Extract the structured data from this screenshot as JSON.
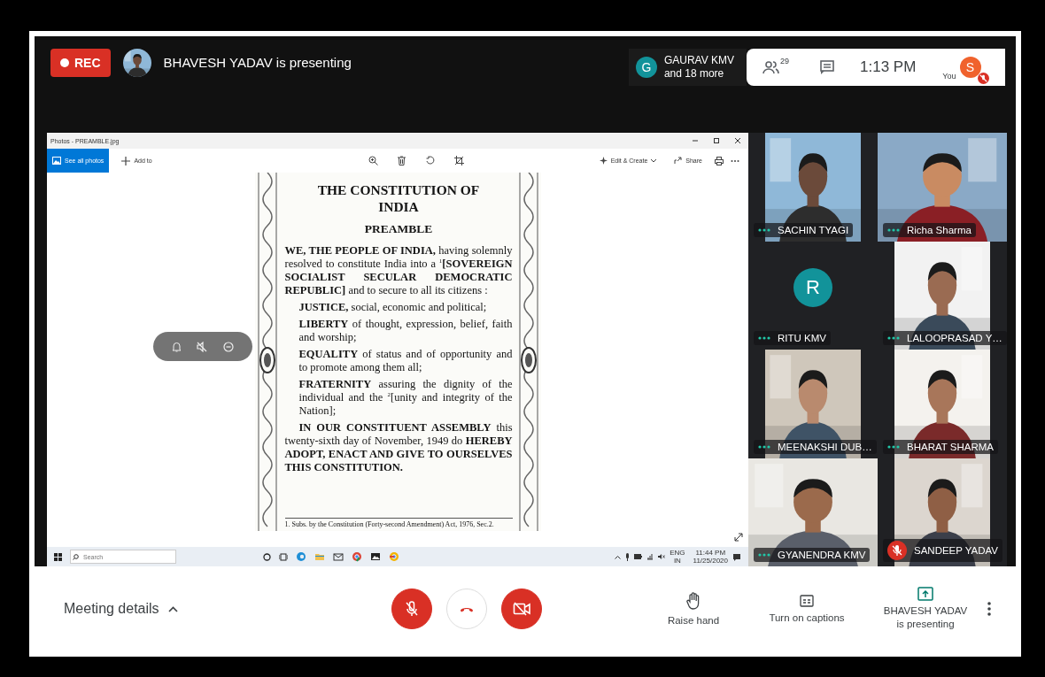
{
  "top_bar": {
    "recording": "REC",
    "presenter_status": "BHAVESH YADAV is presenting",
    "speaker": {
      "initial": "G",
      "name": "GAURAV KMV",
      "others": "and 18 more"
    },
    "participant_count": "29",
    "time": "1:13 PM",
    "self": {
      "initial": "S",
      "label": "You",
      "muted": true
    }
  },
  "photos_window": {
    "title": "Photos - PREAMBLE.jpg",
    "toolbar": [
      {
        "label": "See all photos",
        "selected": true
      },
      {
        "label": "Add to",
        "selected": false
      }
    ],
    "actions": [
      {
        "kind": "edit",
        "label": "Edit & Create"
      },
      {
        "kind": "share",
        "label": "Share"
      }
    ],
    "document": {
      "title": "THE CONSTITUTION OF INDIA",
      "heading": "PREAMBLE",
      "paragraphs": [
        {
          "kind": "body",
          "text": "**WE, THE PEOPLE OF INDIA,** having solemnly resolved to constitute India into a $^{1}$**[SOVEREIGN SOCIALIST SECULAR DEMOCRATIC REPUBLIC]** and to secure to all its citizens :"
        },
        {
          "kind": "indent",
          "text": "**JUSTICE,** social, economic and political;"
        },
        {
          "kind": "indent",
          "text": "**LIBERTY** of thought, expression, belief, faith and worship;"
        },
        {
          "kind": "indent",
          "text": "**EQUALITY** of status and of opportunity and to promote among them all;"
        },
        {
          "kind": "indent",
          "text": "**FRATERNITY** assuring the dignity of the individual and the $^{2}$[unity and integrity of the Nation];"
        },
        {
          "kind": "closing",
          "text": "**IN OUR CONSTITUENT ASSEMBLY** this twenty-sixth day of November, 1949 do **HEREBY ADOPT, ENACT AND GIVE TO OURSELVES THIS CONSTITUTION.**"
        }
      ],
      "footnote": "1. Subs. by the Constitution (Forty-second Amendment) Act, 1976, Sec.2."
    }
  },
  "taskbar": {
    "search": {
      "placeholder": "Search"
    },
    "language": "ENG",
    "region": "IN",
    "time": "11:44 PM",
    "date": "11/25/2020"
  },
  "tiles": [
    {
      "name": "SACHIN TYAGI",
      "kind": "video",
      "muted": false
    },
    {
      "name": "Richa Sharma",
      "kind": "video",
      "muted": false
    },
    {
      "name": "RITU KMV",
      "kind": "avatar",
      "initial": "R",
      "muted": false
    },
    {
      "name": "LALOOPRASAD Y…",
      "kind": "video",
      "muted": false
    },
    {
      "name": "MEENAKSHI DUB…",
      "kind": "video",
      "muted": false
    },
    {
      "name": "BHARAT SHARMA",
      "kind": "video",
      "muted": false
    },
    {
      "name": "GYANENDRA KMV",
      "kind": "video",
      "muted": false
    },
    {
      "name": "SANDEEP YADAV",
      "kind": "video",
      "muted": true
    }
  ],
  "bottom_bar": {
    "meeting_details": "Meeting details",
    "mic_on": false,
    "camera_on": false,
    "actions": [
      {
        "kind": "raise-hand",
        "label": "Raise hand"
      },
      {
        "kind": "captions",
        "label": "Turn on captions"
      }
    ],
    "presenting": {
      "name": "BHAVESH YADAV",
      "status": "is presenting"
    }
  }
}
